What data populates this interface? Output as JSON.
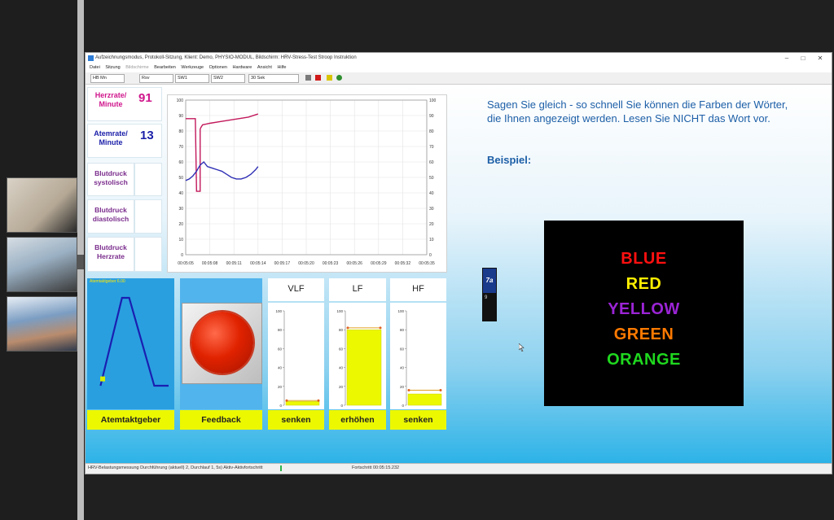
{
  "meeting": {
    "participants": [
      {
        "label": ""
      },
      {
        "label": ""
      },
      {
        "label": ""
      }
    ]
  },
  "window": {
    "title": "Aufzeichnungsmodus, Protokoll-Sitzung, Klient: Demo, PHYSIO-MODUL, Bildschirm: HRV-Stress-Test Stroop Instruktion",
    "controls": [
      "–",
      "□",
      "✕"
    ]
  },
  "menu": [
    "Datei",
    "Sitzung",
    "Bildschirme",
    "Bearbeiten",
    "Werkzeuge",
    "Optionen",
    "Hardware",
    "Ansicht",
    "Hilfe"
  ],
  "toolbar": {
    "fields": [
      "HB Mn",
      "Rsv",
      "SW1",
      "SW2",
      "30 Sek"
    ],
    "button_colors": [
      "#7a7a7a",
      "#d11a1a",
      "#d8c400",
      "#2f8f2f"
    ]
  },
  "vitals": {
    "heart_rate": {
      "label_line1": "Herzrate/",
      "label_line2": "Minute",
      "value": "91",
      "color": "#d0168c"
    },
    "resp_rate": {
      "label_line1": "Atemrate/",
      "label_line2": "Minute",
      "value": "13",
      "color": "#1b1fa8"
    },
    "bp_sys": {
      "label_line1": "Blutdruck",
      "label_line2": "systolisch"
    },
    "bp_dia": {
      "label_line1": "Blutdruck",
      "label_line2": "diastolisch"
    },
    "bp_hr": {
      "label_line1": "Blutdruck",
      "label_line2": "Herzrate"
    }
  },
  "chart_data": {
    "type": "line",
    "ylim": [
      0,
      100
    ],
    "y_ticks": [
      "100",
      "90",
      "80",
      "70",
      "60",
      "50",
      "40",
      "30",
      "20",
      "10",
      "0"
    ],
    "x_ticks": [
      "00:05:05",
      "00:05:08",
      "00:05:11",
      "00:05:14",
      "00:05:17",
      "00:05:20",
      "00:05:23",
      "00:05:26",
      "00:05:29",
      "00:05:32",
      "00:05:35"
    ],
    "series": [
      {
        "color": "#c2185b",
        "x": [
          0,
          0.3,
          0.35,
          0.4,
          0.45,
          0.5,
          0.55,
          0.6,
          0.6,
          0.62,
          0.7,
          1.0,
          1.4,
          1.8,
          2.2,
          2.6,
          3.0
        ],
        "y": [
          88,
          88,
          88,
          88,
          41,
          41,
          41,
          41,
          81,
          82,
          84,
          85,
          86,
          87,
          88,
          89,
          91
        ]
      },
      {
        "color": "#2f2fb5",
        "x": [
          0,
          0.15,
          0.3,
          0.45,
          0.6,
          0.75,
          0.9,
          1.1,
          1.3,
          1.5,
          1.7,
          1.9,
          2.1,
          2.3,
          2.5,
          2.7,
          2.9,
          3.0
        ],
        "y": [
          48,
          49,
          51,
          54,
          58,
          60,
          57,
          56,
          55,
          54,
          52,
          50,
          49,
          49,
          50,
          52,
          55,
          57
        ]
      }
    ]
  },
  "pacer": {
    "title": "Atemtaktgeber 6.00",
    "label": "Atemtaktgeber",
    "points": [
      [
        0.05,
        0.95
      ],
      [
        0.35,
        0.05
      ],
      [
        0.45,
        0.05
      ],
      [
        0.8,
        0.95
      ],
      [
        1.0,
        0.95
      ]
    ],
    "cursor": [
      0.08,
      0.88
    ]
  },
  "feedback": {
    "label": "Feedback"
  },
  "frequency_bands": [
    {
      "name": "VLF",
      "label": "senken",
      "value": 4,
      "target": 5
    },
    {
      "name": "LF",
      "label": "erhöhen",
      "value": 80,
      "target": 82
    },
    {
      "name": "HF",
      "label": "senken",
      "value": 12,
      "target": 16
    }
  ],
  "freq_y_ticks": [
    "100",
    "80",
    "60",
    "40",
    "20",
    "0"
  ],
  "instruction": {
    "text": "Sagen Sie gleich - so schnell Sie können die Farben der Wörter, die Ihnen angezeigt werden. Lesen Sie NICHT das Wort vor.",
    "example_label": "Beispiel:"
  },
  "stroop": [
    {
      "word": "BLUE",
      "color": "#ff1010"
    },
    {
      "word": "RED",
      "color": "#ffef00"
    },
    {
      "word": "YELLOW",
      "color": "#9b24d6"
    },
    {
      "word": "GREEN",
      "color": "#ff7a00"
    },
    {
      "word": "ORANGE",
      "color": "#1fd81f"
    }
  ],
  "side_widget": {
    "logo": "7a",
    "number": "9"
  },
  "status": {
    "left": "HRV-Belastungsmessung Durchführung (aktuell) 2, Durchlauf 1, 5s) Aktiv-Aktivfortschritt",
    "right": "Fortschritt 00:05:15.232"
  }
}
